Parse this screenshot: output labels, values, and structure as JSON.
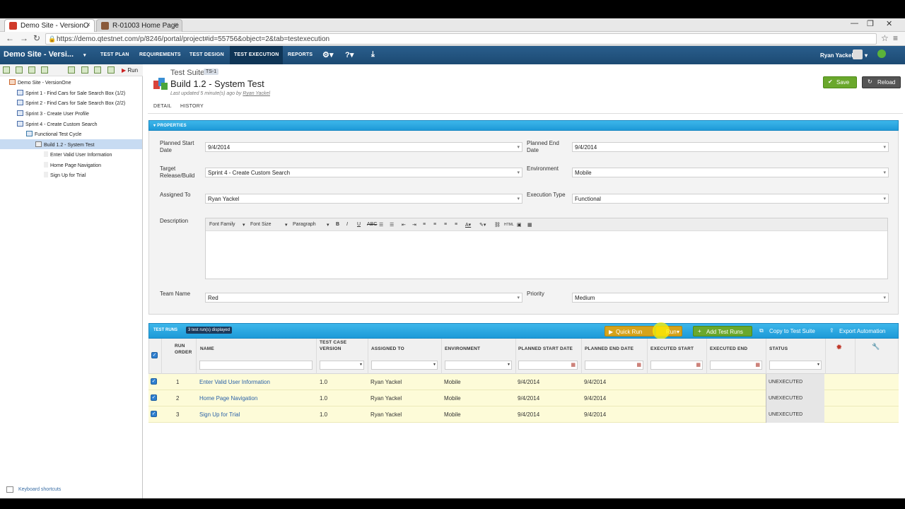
{
  "browser": {
    "tabs": [
      {
        "label": "Demo Site - VersionO",
        "close": "×"
      },
      {
        "label": "R-01003 Home Page",
        "close": "×"
      }
    ],
    "url": "https://demo.qtestnet.com/p/8246/portal/project#id=55756&object=2&tab=testexecution",
    "window_controls": [
      "—",
      "❐",
      "✕"
    ]
  },
  "app": {
    "project_title": "Demo Site - Versi...",
    "nav": [
      "TEST PLAN",
      "REQUIREMENTS",
      "TEST DESIGN",
      "TEST EXECUTION",
      "REPORTS"
    ],
    "active_nav": "TEST EXECUTION",
    "user": "Ryan Yackel"
  },
  "tree": {
    "run_label": "Run",
    "items": [
      {
        "label": "Demo Site - VersionOne"
      },
      {
        "label": "Sprint 1 - Find Cars for Sale Search Box (1/2)"
      },
      {
        "label": "Sprint 2 - Find Cars for Sale Search Box (2/2)"
      },
      {
        "label": "Sprint 3 - Create User Profile"
      },
      {
        "label": "Sprint 4 - Create Custom Search"
      },
      {
        "label": "Functional Test Cycle"
      },
      {
        "label": "Build 1.2 - System Test"
      },
      {
        "label": "Enter Valid User Information"
      },
      {
        "label": "Home Page Navigation"
      },
      {
        "label": "Sign Up for Trial"
      }
    ],
    "keyboard_shortcuts": "Keyboard shortcuts"
  },
  "suite": {
    "type_label": "Test Suite",
    "id": "TS-1",
    "title": "Build 1.2 - System Test",
    "updated": "Last updated 5 minute(s) ago by",
    "updated_by": "Ryan Yackel",
    "save": "Save",
    "reload": "Reload",
    "tabs": [
      "DETAIL",
      "HISTORY"
    ]
  },
  "properties": {
    "header": "▾ PROPERTIES",
    "planned_start_label": "Planned Start Date",
    "planned_start": "9/4/2014",
    "planned_end_label": "Planned End Date",
    "planned_end": "9/4/2014",
    "target_label": "Target Release/Build",
    "target": "Sprint 4 - Create Custom Search",
    "environment_label": "Environment",
    "environment": "Mobile",
    "assigned_label": "Assigned To",
    "assigned": "Ryan Yackel",
    "exec_type_label": "Execution Type",
    "exec_type": "Functional",
    "description_label": "Description",
    "editor": {
      "font_family": "Font Family",
      "font_size": "Font Size",
      "paragraph": "Paragraph",
      "html": "HTML"
    },
    "team_label": "Team Name",
    "team": "Red",
    "priority_label": "Priority",
    "priority": "Medium"
  },
  "runs": {
    "title": "TEST RUNS",
    "count": "3 test run(s) displayed",
    "quick_run": "Quick Run",
    "run": "Run",
    "add_test_runs": "Add Test Runs",
    "copy_to_suite": "Copy to Test Suite",
    "export_automation": "Export Automation",
    "columns": [
      "RUN ORDER",
      "NAME",
      "TEST CASE VERSION",
      "ASSIGNED TO",
      "ENVIRONMENT",
      "PLANNED START DATE",
      "PLANNED END DATE",
      "EXECUTED START",
      "EXECUTED END",
      "STATUS"
    ],
    "rows": [
      {
        "order": "1",
        "name": "Enter Valid User Information",
        "version": "1.0",
        "assigned": "Ryan Yackel",
        "env": "Mobile",
        "start": "9/4/2014",
        "end": "9/4/2014",
        "status": "UNEXECUTED"
      },
      {
        "order": "2",
        "name": "Home Page Navigation",
        "version": "1.0",
        "assigned": "Ryan Yackel",
        "env": "Mobile",
        "start": "9/4/2014",
        "end": "9/4/2014",
        "status": "UNEXECUTED"
      },
      {
        "order": "3",
        "name": "Sign Up for Trial",
        "version": "1.0",
        "assigned": "Ryan Yackel",
        "env": "Mobile",
        "start": "9/4/2014",
        "end": "9/4/2014",
        "status": "UNEXECUTED"
      }
    ]
  },
  "colors": {
    "header_blue": "#1f4e79",
    "section_blue": "#2aa8e0",
    "row_yellow": "#fdfbd8",
    "save_green": "#6aa82c"
  }
}
